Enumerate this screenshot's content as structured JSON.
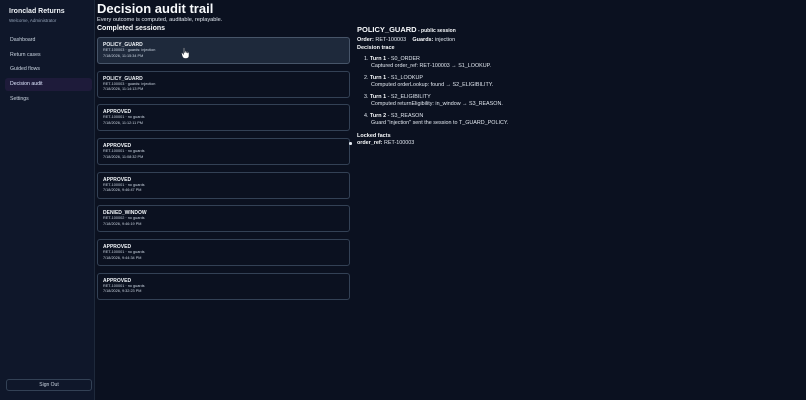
{
  "app": {
    "brand": "Ironclad Returns",
    "welcome": "Welcome, Administrator"
  },
  "nav": {
    "items": [
      {
        "label": "Dashboard"
      },
      {
        "label": "Return cases"
      },
      {
        "label": "Guided flows"
      },
      {
        "label": "Decision audit"
      },
      {
        "label": "Settings"
      }
    ],
    "active_index": 3
  },
  "signout_label": "Sign Out",
  "page": {
    "title": "Decision audit trail",
    "subtitle": "Every outcome is computed, auditable, replayable.",
    "sessions_heading": "Completed sessions"
  },
  "sessions": [
    {
      "status": "POLICY_GUARD",
      "meta": "RET-100003 · guards: injection",
      "time": "7/18/2026, 11:15:34 PM"
    },
    {
      "status": "POLICY_GUARD",
      "meta": "RET-100003 · guards: injection",
      "time": "7/18/2026, 11:14:13 PM"
    },
    {
      "status": "APPROVED",
      "meta": "RET-100001 · no guards",
      "time": "7/18/2026, 11:12:11 PM"
    },
    {
      "status": "APPROVED",
      "meta": "RET-100001 · no guards",
      "time": "7/18/2026, 11:08:32 PM"
    },
    {
      "status": "APPROVED",
      "meta": "RET-100001 · no guards",
      "time": "7/18/2026, 9:46:47 PM"
    },
    {
      "status": "DENIED_WINDOW",
      "meta": "RET-100002 · no guards",
      "time": "7/18/2026, 9:46:19 PM"
    },
    {
      "status": "APPROVED",
      "meta": "RET-100001 · no guards",
      "time": "7/18/2026, 9:44:34 PM"
    },
    {
      "status": "APPROVED",
      "meta": "RET-100001 · no guards",
      "time": "7/18/2026, 9:32:23 PM"
    }
  ],
  "detail": {
    "title": "POLICY_GUARD",
    "title_suffix": " - public session",
    "order_label": "Order:",
    "order_value": " RET-100003",
    "guards_label": "Guards:",
    "guards_value": " injection",
    "trace_heading": "Decision trace",
    "trace": [
      {
        "turn": "Turn 1",
        "state": " - S0_ORDER",
        "desc": "Captured order_ref: RET-100003 → S1_LOOKUP."
      },
      {
        "turn": "Turn 1",
        "state": " - S1_LOOKUP",
        "desc": "Computed orderLookup: found → S2_ELIGIBILITY."
      },
      {
        "turn": "Turn 1",
        "state": " - S2_ELIGIBILITY",
        "desc": "Computed returnEligibility: in_window → S3_REASON."
      },
      {
        "turn": "Turn 2",
        "state": " - S3_REASON",
        "desc": "Guard \"injection\" sent the session to T_GUARD_POLICY."
      }
    ],
    "locked_heading": "Locked facts",
    "facts": [
      {
        "key": "order_ref:",
        "value": " RET-100003"
      }
    ]
  },
  "colors": {
    "background": "#0b1120",
    "sidebar": "#0f172a",
    "active_nav": "#1e1b3a",
    "selected_card": "#1e293b"
  }
}
